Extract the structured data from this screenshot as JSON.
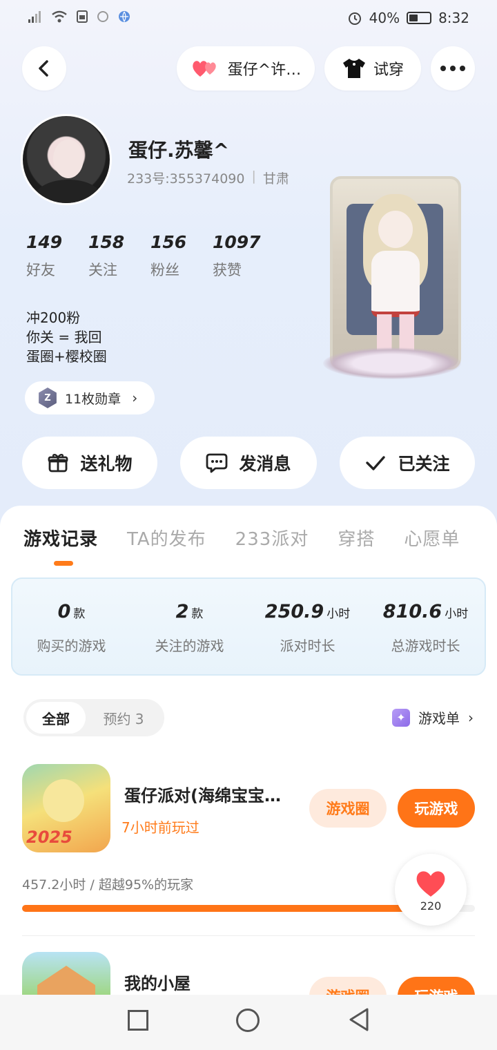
{
  "status_bar": {
    "battery": "40%",
    "time": "8:32",
    "icons": [
      "signal-icon",
      "wifi-icon",
      "sim-icon",
      "notification-icon",
      "browser-icon",
      "alarm-icon",
      "battery-icon"
    ]
  },
  "header": {
    "dress_label": "蛋仔^许…",
    "try_on_label": "试穿"
  },
  "profile": {
    "nickname": "蛋仔.苏馨^",
    "uid": "233号:355374090",
    "region": "甘肃",
    "stats": [
      {
        "value": "149",
        "label": "好友"
      },
      {
        "value": "158",
        "label": "关注"
      },
      {
        "value": "156",
        "label": "粉丝"
      },
      {
        "value": "1097",
        "label": "获赞"
      }
    ],
    "bio_lines": [
      "冲200粉",
      "你关 = 我回",
      "蛋圈+樱校圈"
    ],
    "medal_label": "11枚勋章",
    "medal_icon_text": "Z"
  },
  "actions": {
    "gift": "送礼物",
    "message": "发消息",
    "follow": "已关注"
  },
  "tabs": [
    "游戏记录",
    "TA的发布",
    "233派对",
    "穿搭",
    "心愿单"
  ],
  "active_tab": 0,
  "summary": [
    {
      "value": "0",
      "unit": "款",
      "label": "购买的游戏"
    },
    {
      "value": "2",
      "unit": "款",
      "label": "关注的游戏"
    },
    {
      "value": "250.9",
      "unit": "小时",
      "label": "派对时长"
    },
    {
      "value": "810.6",
      "unit": "小时",
      "label": "总游戏时长"
    }
  ],
  "filter": {
    "all": "全部",
    "reserve": "预约 3",
    "game_list": "游戏单"
  },
  "games": [
    {
      "title": "蛋仔派对(海绵宝宝…",
      "subtitle": "7小时前玩过",
      "icon_text": "2025",
      "circle_btn": "游戏圈",
      "play_btn": "玩游戏",
      "playtime": "457.2小时 / 超越95%的玩家",
      "progress": 0.95
    },
    {
      "title": "我的小屋",
      "circle_btn": "游戏圈",
      "play_btn": "玩游戏"
    }
  ],
  "like": {
    "count": "220"
  },
  "colors": {
    "accent": "#ff7417",
    "accent_soft": "#feeadd",
    "heart": "#ff4d55"
  }
}
